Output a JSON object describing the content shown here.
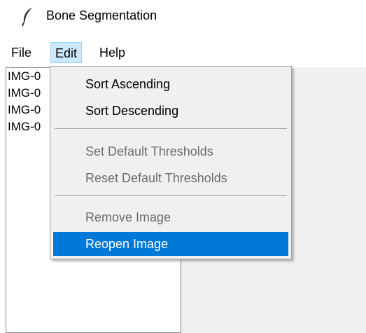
{
  "window": {
    "title": "Bone Segmentation",
    "icon": "feather-icon"
  },
  "menubar": {
    "items": [
      {
        "label": "File"
      },
      {
        "label": "Edit"
      },
      {
        "label": "Help"
      }
    ]
  },
  "file_list": {
    "items": [
      {
        "label": "IMG-0"
      },
      {
        "label": "IMG-0"
      },
      {
        "label": "IMG-0"
      },
      {
        "label": "IMG-0"
      }
    ]
  },
  "edit_menu": {
    "sort_ascending": "Sort Ascending",
    "sort_descending": "Sort Descending",
    "set_default_thresholds": "Set Default Thresholds",
    "reset_default_thresholds": "Reset Default Thresholds",
    "remove_image": "Remove Image",
    "reopen_image": "Reopen Image"
  },
  "colors": {
    "highlight": "#0078d7",
    "menu_hover": "#cce8ff",
    "disabled_text": "#6d6d6d"
  }
}
